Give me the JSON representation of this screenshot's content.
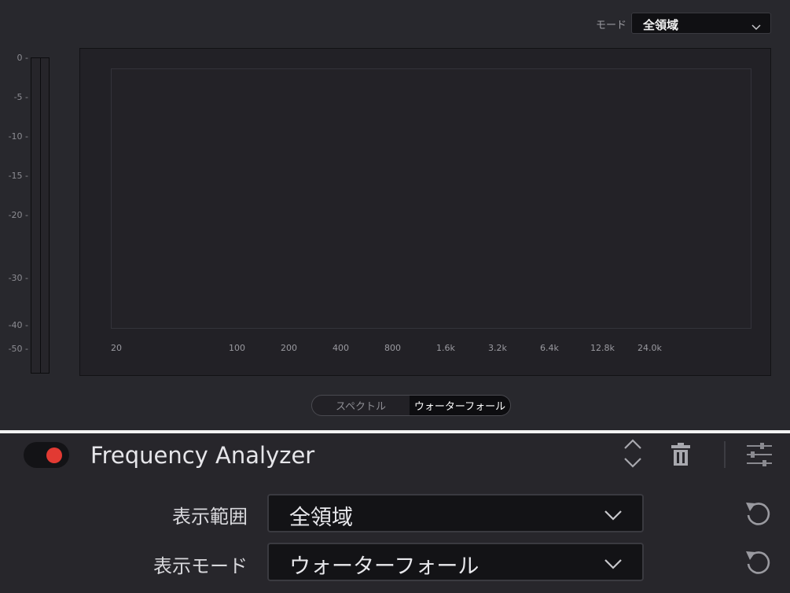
{
  "top_mode": {
    "label": "モード",
    "value": "全領域"
  },
  "db_scale": [
    "0 -",
    "-5 -",
    "-10 -",
    "-15 -",
    "-20 -",
    "-30 -",
    "-40 -",
    "-50 -"
  ],
  "freq_scale": [
    "20",
    "100",
    "200",
    "400",
    "800",
    "1.6k",
    "3.2k",
    "6.4k",
    "12.8k",
    "24.0k"
  ],
  "view_toggle": {
    "options": [
      "スペクトル",
      "ウォーターフォール"
    ],
    "selected": "ウォーターフォール"
  },
  "plugin": {
    "name": "Frequency Analyzer",
    "enabled": true,
    "toggle_color": "#e23a33"
  },
  "params": [
    {
      "label": "表示範囲",
      "value": "全領域"
    },
    {
      "label": "表示モード",
      "value": "ウォーターフォール"
    }
  ],
  "icons": [
    "chevron-down-icon",
    "collapse-expand-icon",
    "trash-icon",
    "sliders-icon",
    "reset-icon"
  ]
}
